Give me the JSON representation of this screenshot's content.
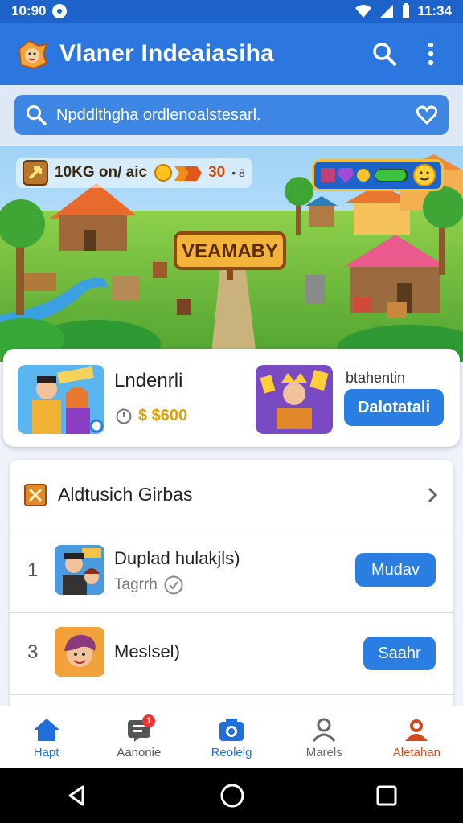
{
  "status_bar": {
    "time_left": "10:90",
    "time_right": "11:34"
  },
  "app_bar": {
    "title": "Vlaner Indeaiasiha"
  },
  "search": {
    "text": "Npddlthgha ordlenoalstesarl."
  },
  "banner": {
    "hud_left_text": "10KG on/ aic",
    "hud_left_gold": "30",
    "hud_left_small": "• 8",
    "sign_text": "VEAMABY"
  },
  "promo": {
    "title": "Lndenrli",
    "price": "$ $600",
    "subtitle": "btahentin",
    "button_label": "Dalotatali"
  },
  "list": {
    "header_title": "Aldtusich Girbas",
    "rows": [
      {
        "rank": "1",
        "title": "Duplad hulakjls)",
        "sub": "Tagrrh",
        "button": "Mudav"
      },
      {
        "rank": "3",
        "title": "Meslsel)",
        "sub": "",
        "button": "Saahr"
      }
    ]
  },
  "bottom_nav": {
    "items": [
      {
        "label": "Hapt",
        "color": "#1e6fd9"
      },
      {
        "label": "Aanonie",
        "color": "#555555"
      },
      {
        "label": "Reolelg",
        "color": "#1e6fd9"
      },
      {
        "label": "Marels",
        "color": "#666666"
      },
      {
        "label": "Aletahan",
        "color": "#d14a1a"
      }
    ],
    "badge": "1"
  },
  "colors": {
    "primary": "#2b76df",
    "button": "#2a7ee2",
    "accent_orange": "#d14a1a"
  }
}
